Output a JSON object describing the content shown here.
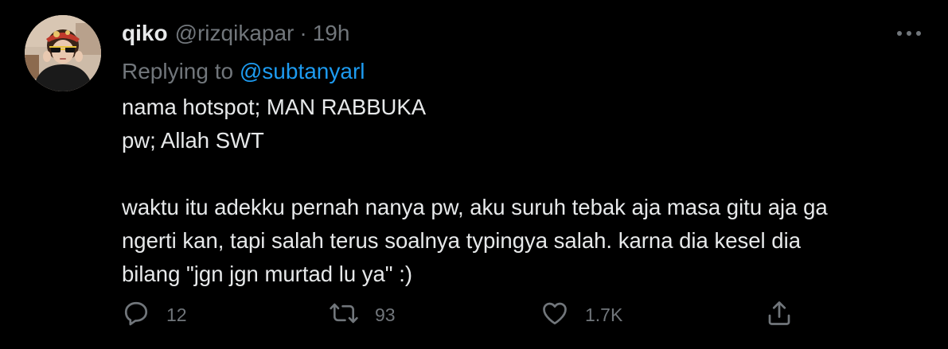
{
  "tweet": {
    "display_name": "qiko",
    "handle": "@rizqikapar",
    "separator": "·",
    "time": "19h",
    "replying_prefix": "Replying to",
    "replying_to": "@subtanyarl",
    "body_lines": [
      "nama hotspot; MAN RABBUKA",
      "pw; Allah SWT",
      "",
      "waktu itu adekku pernah nanya pw, aku suruh tebak aja masa gitu aja ga",
      "ngerti kan, tapi salah terus soalnya typingya salah. karna dia kesel dia",
      "bilang \"jgn jgn murtad lu ya\" :)"
    ],
    "actions": {
      "reply_count": "12",
      "retweet_count": "93",
      "like_count": "1.7K"
    }
  },
  "icons": {
    "more": "more-horizontal-icon",
    "reply": "reply-bubble-icon",
    "retweet": "retweet-icon",
    "like": "heart-icon",
    "share": "share-upload-icon"
  },
  "colors": {
    "background": "#000000",
    "text": "#e7e9ea",
    "muted": "#71767b",
    "link": "#1d9bf0"
  }
}
